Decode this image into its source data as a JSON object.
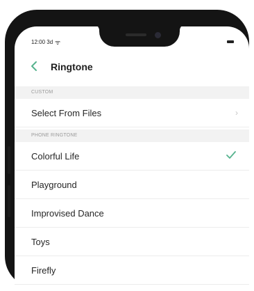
{
  "status": {
    "time": "12:00 3d",
    "wifi_icon": "wifi-icon",
    "battery_icon": "battery-icon"
  },
  "header": {
    "title": "Ringtone",
    "back_icon": "back-arrow-icon"
  },
  "sections": {
    "custom": {
      "label": "CUSTOM",
      "item": "Select From Files"
    },
    "phone": {
      "label": "PHONE RINGTONE",
      "items": [
        "Colorful Life",
        "Playground",
        "Improvised Dance",
        "Toys",
        "Firefly"
      ],
      "selected": "Colorful Life"
    }
  },
  "colors": {
    "accent": "#56b38e",
    "section_bg": "#f2f2f2"
  }
}
